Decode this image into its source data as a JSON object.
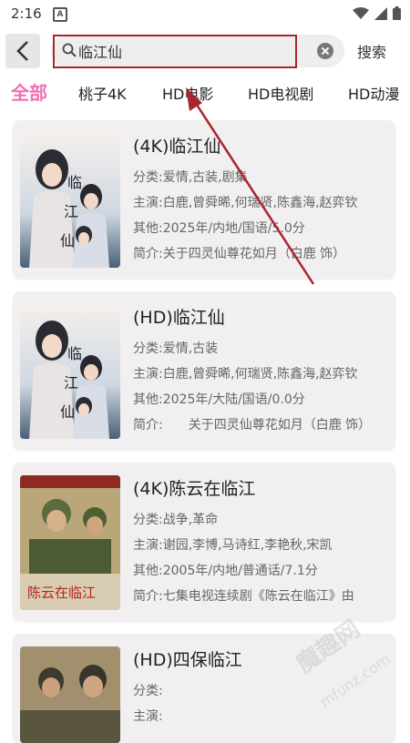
{
  "status": {
    "time": "2:16",
    "app_icon_letter": "A"
  },
  "search": {
    "value": "临江仙",
    "submit_label": "搜索"
  },
  "tabs": [
    {
      "label": "全部",
      "active": true
    },
    {
      "label": "桃子4K",
      "active": false
    },
    {
      "label": "HD电影",
      "active": false
    },
    {
      "label": "HD电视剧",
      "active": false
    },
    {
      "label": "HD动漫",
      "active": false
    }
  ],
  "results": [
    {
      "title": "(4K)临江仙",
      "category_label": "分类:",
      "category": "爱情,古装,剧集",
      "cast_label": "主演:",
      "cast": "白鹿,曾舜晞,何瑞贤,陈鑫海,赵弈钦",
      "other_label": "其他:",
      "other": "2025年/内地/国语/5.0分",
      "intro_label": "简介:",
      "intro": "关于四灵仙尊花如月（白鹿 饰）"
    },
    {
      "title": "(HD)临江仙",
      "category_label": "分类:",
      "category": "爱情,古装",
      "cast_label": "主演:",
      "cast": "白鹿,曾舜晞,何瑞贤,陈鑫海,赵弈钦",
      "other_label": "其他:",
      "other": "2025年/大陆/国语/0.0分",
      "intro_label": "简介:",
      "intro": "　　关于四灵仙尊花如月（白鹿 饰）"
    },
    {
      "title": "(4K)陈云在临江",
      "category_label": "分类:",
      "category": "战争,革命",
      "cast_label": "主演:",
      "cast": "谢园,李博,马诗红,李艳秋,宋凯",
      "other_label": "其他:",
      "other": "2005年/内地/普通话/7.1分",
      "intro_label": "简介:",
      "intro": "七集电视连续剧《陈云在临江》由"
    },
    {
      "title": "(HD)四保临江",
      "category_label": "分类:",
      "category": "",
      "cast_label": "主演:",
      "cast": "",
      "other_label": "",
      "other": "",
      "intro_label": "",
      "intro": ""
    }
  ],
  "watermark": {
    "text": "魔趣网",
    "sub": "mfunz.com"
  },
  "colors": {
    "active_tab": "#ef6fb4",
    "highlight": "#a8262e"
  }
}
